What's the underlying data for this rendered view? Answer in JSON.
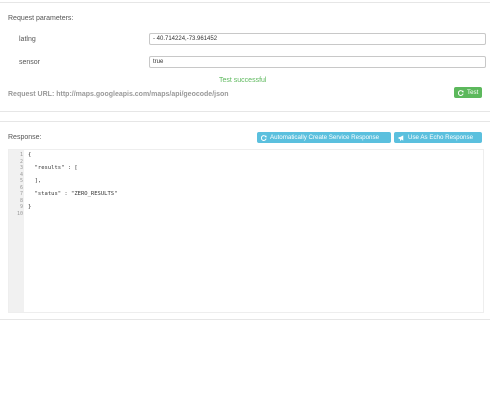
{
  "request": {
    "heading": "Request parameters:",
    "params": [
      {
        "name": "latlng",
        "value": "- 40.714224,-73.961452"
      },
      {
        "name": "sensor",
        "value": "true"
      }
    ],
    "status_text": "Test successful",
    "url_label": "Request URL: http://maps.googleapis.com/maps/api/geocode/json",
    "test_button": "Test"
  },
  "response": {
    "heading": "Response:",
    "create_button": "Automatically Create Service Response",
    "echo_button": "Use As Echo Response",
    "close_icon": "close-icon",
    "line_numbers": [
      "1",
      "2",
      "3",
      "4",
      "5",
      "6",
      "7",
      "8",
      "9",
      "10"
    ],
    "lines": [
      "{",
      "",
      "  \"results\" : [",
      "",
      "  ],",
      "",
      "  \"status\" : \"ZERO_RESULTS\"",
      "",
      "}",
      ""
    ]
  },
  "colors": {
    "success_text": "#5cb85c",
    "green_button": "#5cb85c",
    "blue_button": "#5bc0de"
  }
}
